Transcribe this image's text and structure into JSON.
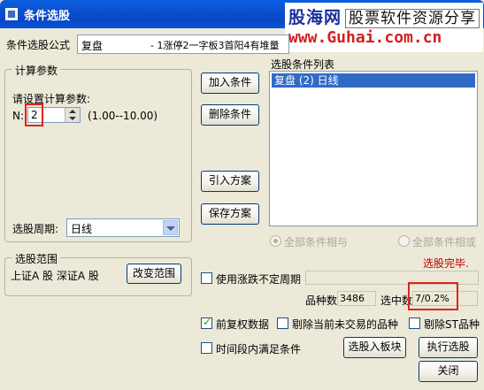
{
  "window": {
    "title": "条件选股"
  },
  "watermark": {
    "brand": "股海网",
    "tagline": "股票软件资源分享",
    "url": "www.Guhai.com.cn"
  },
  "formula": {
    "label": "条件选股公式",
    "name": "复盘",
    "desc": "- 1涨停2一字板3首阳4有堆量"
  },
  "params": {
    "group_title": "计算参数",
    "prompt": "请设置计算参数:",
    "n_label": "N:",
    "n_value": "2",
    "n_range": "(1.00--10.00)",
    "period_label": "选股周期:",
    "period_value": "日线"
  },
  "buttons": {
    "add": "加入条件",
    "remove": "删除条件",
    "import": "引入方案",
    "save": "保存方案",
    "change_range": "改变范围",
    "to_block": "选股入板块",
    "execute": "执行选股",
    "close": "关闭"
  },
  "conditions": {
    "title": "选股条件列表",
    "items": [
      "复盘  (2)  日线"
    ]
  },
  "logic": {
    "and_label": "全部条件相与",
    "or_label": "全部条件相或"
  },
  "status": {
    "done": "选股完毕.",
    "status_color": "#c00000"
  },
  "scope": {
    "group_title": "选股范围",
    "value": "上证A 股  深证A 股"
  },
  "options": {
    "variable_period": "使用涨跌不定周期",
    "pre_adjust": "前复权数据",
    "exclude_untraded": "剔除当前未交易的品种",
    "exclude_st": "剔除ST品种",
    "in_period": "时间段内满足条件"
  },
  "stats": {
    "count_label": "品种数",
    "count_value": "3486",
    "selected_label": "选中数",
    "selected_value": "7/0.2%"
  }
}
